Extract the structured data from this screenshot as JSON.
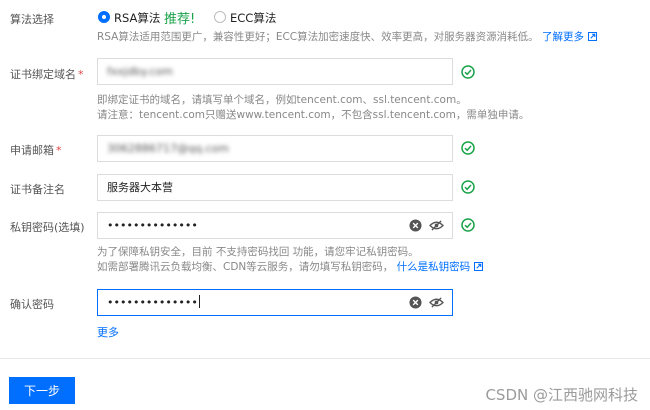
{
  "algorithm": {
    "label": "算法选择",
    "options": [
      {
        "label": "RSA算法",
        "selected": true
      },
      {
        "label": "ECC算法",
        "selected": false
      }
    ],
    "recommend": "推荐!",
    "help": "RSA算法适用范围更广，兼容性更好；ECC算法加密速度快、效率更高，对服务器资源消耗低。",
    "learn_more": "了解更多"
  },
  "domain": {
    "label": "证书绑定域名",
    "value": "fxxjdby.com",
    "help_line1": "即绑定证书的域名，请填写单个域名，例如tencent.com、ssl.tencent.com。",
    "help_line2": "请注意：tencent.com只赠送www.tencent.com，不包含ssl.tencent.com，需单独申请。"
  },
  "email": {
    "label": "申请邮箱",
    "value": "3062886717@qq.com"
  },
  "remark": {
    "label": "证书备注名",
    "value": "服务器大本营"
  },
  "private_key": {
    "label": "私钥密码(选填)",
    "value": "••••••••••••••",
    "help_line1": "为了保障私钥安全，目前 不支持密码找回 功能，请您牢记私钥密码。",
    "help_line2": "如需部署腾讯云负载均衡、CDN等云服务，请勿填写私钥密码，",
    "help_link": "什么是私钥密码"
  },
  "confirm_key": {
    "label": "确认密码",
    "value": "••••••••••••••"
  },
  "more": "更多",
  "next_button": "下一步",
  "watermark": "CSDN @江西驰网科技",
  "colors": {
    "primary": "#006eff",
    "success": "#1aa34a",
    "required": "#e54545"
  }
}
